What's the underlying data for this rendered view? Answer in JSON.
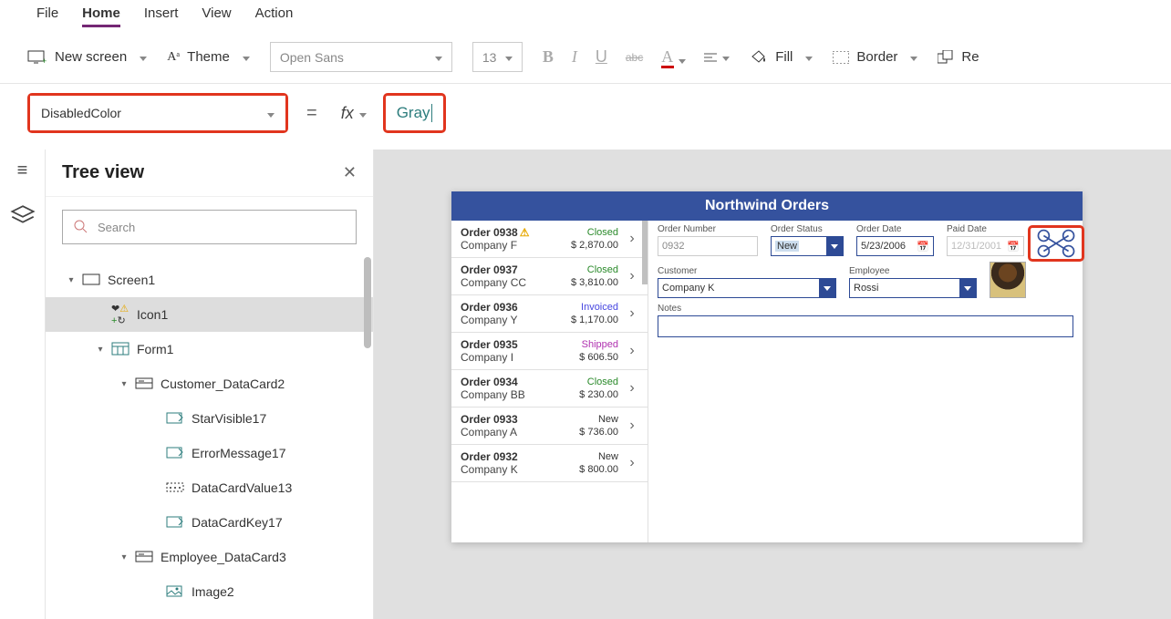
{
  "menu": {
    "file": "File",
    "home": "Home",
    "insert": "Insert",
    "view": "View",
    "action": "Action"
  },
  "ribbon": {
    "new_screen": "New screen",
    "theme": "Theme",
    "font": "Open Sans",
    "size": "13",
    "fill": "Fill",
    "border": "Border",
    "reorder": "Re"
  },
  "formula": {
    "property": "DisabledColor",
    "fx": "fx",
    "value": "Gray"
  },
  "treeview": {
    "title": "Tree view",
    "search_placeholder": "Search",
    "items": [
      {
        "lv": 1,
        "label": "Screen1",
        "icon": "screen",
        "exp": true
      },
      {
        "lv": 2,
        "label": "Icon1",
        "icon": "icon",
        "selected": true
      },
      {
        "lv": 2,
        "label": "Form1",
        "icon": "form",
        "exp": true
      },
      {
        "lv": 3,
        "label": "Customer_DataCard2",
        "icon": "card",
        "exp": true
      },
      {
        "lv": 4,
        "label": "StarVisible17",
        "icon": "label"
      },
      {
        "lv": 4,
        "label": "ErrorMessage17",
        "icon": "label"
      },
      {
        "lv": 4,
        "label": "DataCardValue13",
        "icon": "input"
      },
      {
        "lv": 4,
        "label": "DataCardKey17",
        "icon": "label"
      },
      {
        "lv": 3,
        "label": "Employee_DataCard3",
        "icon": "card",
        "exp": true
      },
      {
        "lv": 4,
        "label": "Image2",
        "icon": "image"
      }
    ]
  },
  "app": {
    "title": "Northwind Orders",
    "orders": [
      {
        "id": "Order 0938",
        "company": "Company F",
        "status": "Closed",
        "status_cls": "st-closed",
        "amount": "$ 2,870.00",
        "warn": true
      },
      {
        "id": "Order 0937",
        "company": "Company CC",
        "status": "Closed",
        "status_cls": "st-closed",
        "amount": "$ 3,810.00"
      },
      {
        "id": "Order 0936",
        "company": "Company Y",
        "status": "Invoiced",
        "status_cls": "st-invoiced",
        "amount": "$ 1,170.00"
      },
      {
        "id": "Order 0935",
        "company": "Company I",
        "status": "Shipped",
        "status_cls": "st-shipped",
        "amount": "$ 606.50"
      },
      {
        "id": "Order 0934",
        "company": "Company BB",
        "status": "Closed",
        "status_cls": "st-closed",
        "amount": "$ 230.00"
      },
      {
        "id": "Order 0933",
        "company": "Company A",
        "status": "New",
        "status_cls": "st-new",
        "amount": "$ 736.00"
      },
      {
        "id": "Order 0932",
        "company": "Company K",
        "status": "New",
        "status_cls": "st-new",
        "amount": "$ 800.00"
      }
    ],
    "detail": {
      "labels": {
        "order_number": "Order Number",
        "order_status": "Order Status",
        "order_date": "Order Date",
        "paid_date": "Paid Date",
        "customer": "Customer",
        "employee": "Employee",
        "notes": "Notes"
      },
      "order_number": "0932",
      "order_status": "New",
      "order_date": "5/23/2006",
      "paid_date": "12/31/2001",
      "customer": "Company K",
      "employee": "Rossi"
    }
  }
}
